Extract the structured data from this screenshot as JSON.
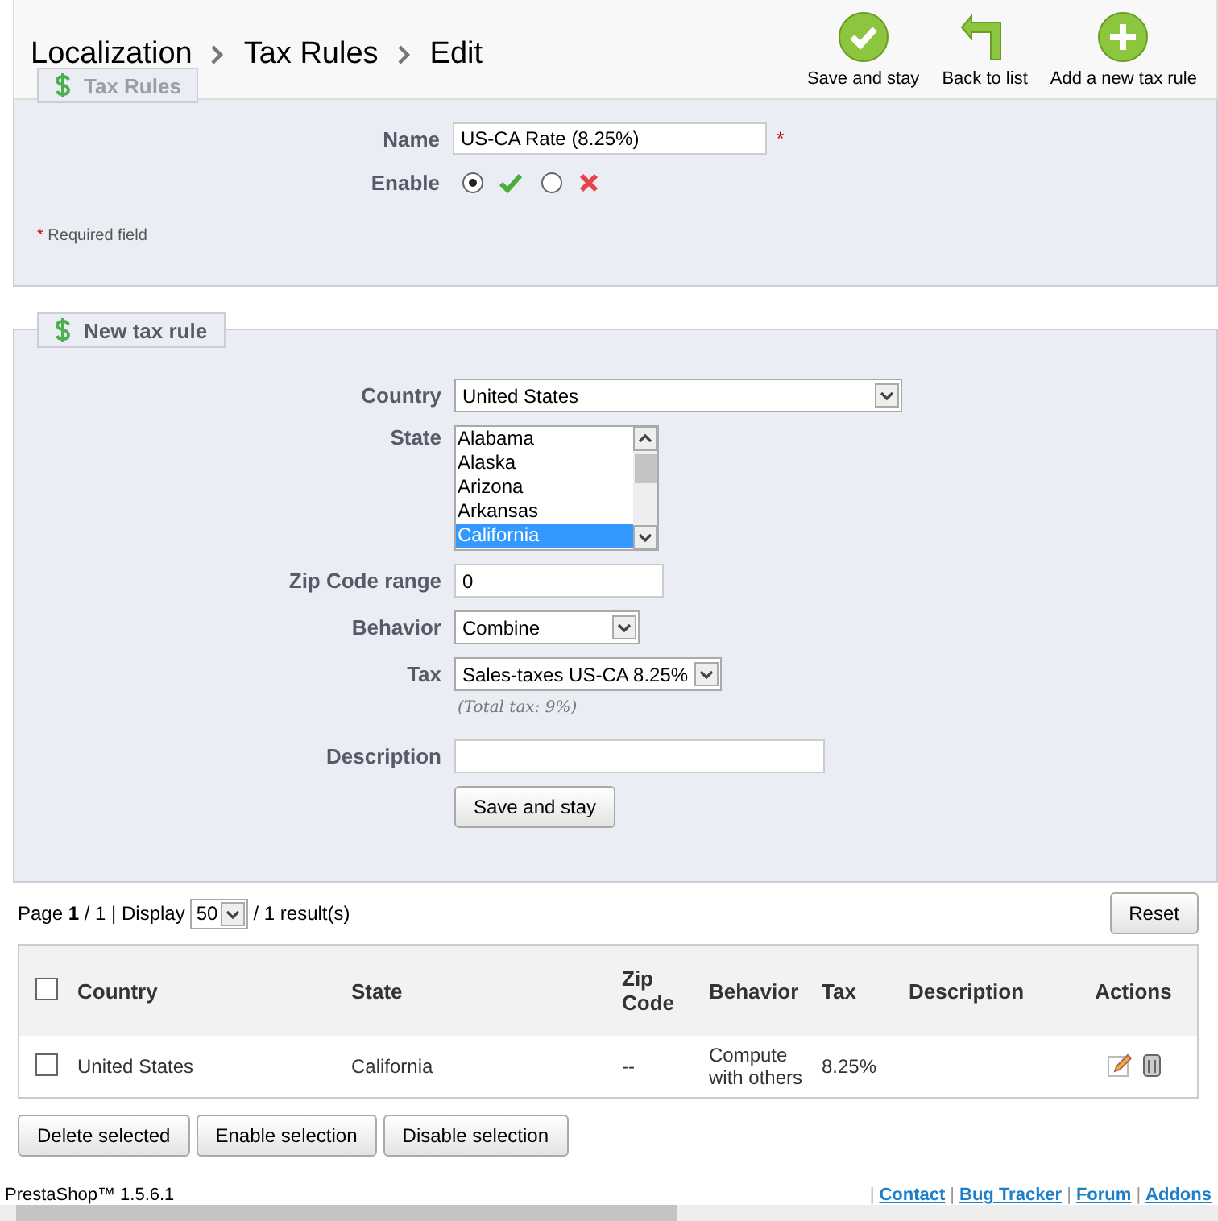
{
  "header": {
    "breadcrumb": [
      "Localization",
      "Tax Rules",
      "Edit"
    ],
    "toolbar": [
      {
        "kind": "save",
        "label": "Save and stay"
      },
      {
        "kind": "back",
        "label": "Back to list"
      },
      {
        "kind": "add",
        "label": "Add a new tax rule"
      }
    ]
  },
  "rule_form": {
    "legend": "Tax Rules",
    "name": {
      "label": "Name",
      "value": "US-CA Rate (8.25%)",
      "required_mark": "*"
    },
    "enable": {
      "label": "Enable",
      "options": [
        {
          "kind": "yes",
          "selected": true
        },
        {
          "kind": "no",
          "selected": false
        }
      ]
    },
    "required_note": {
      "mark": "*",
      "text": "Required field"
    }
  },
  "new_rule": {
    "legend": "New tax rule",
    "country": {
      "label": "Country",
      "value": "United States"
    },
    "state": {
      "label": "State",
      "options": [
        {
          "label": "Alabama",
          "selected": false
        },
        {
          "label": "Alaska",
          "selected": false
        },
        {
          "label": "Arizona",
          "selected": false
        },
        {
          "label": "Arkansas",
          "selected": false
        },
        {
          "label": "California",
          "selected": true
        }
      ]
    },
    "zip": {
      "label": "Zip Code range",
      "value": "0"
    },
    "behavior": {
      "label": "Behavior",
      "value": "Combine"
    },
    "tax": {
      "label": "Tax",
      "value": "Sales-taxes US-CA 8.25%",
      "note": "(Total tax: 9%)"
    },
    "description": {
      "label": "Description"
    },
    "button": "Save and stay"
  },
  "list": {
    "pagination": "Page **1** / 1 | Display",
    "per_page": "50",
    "results": "/ 1 result(s)",
    "reset": "Reset",
    "select_all": {
      "checked": false
    },
    "columns": [
      "Country",
      "State",
      "Zip Code",
      "Behavior",
      "Tax",
      "Description",
      "Actions"
    ],
    "rows": [
      {
        "checked": false,
        "cells": [
          "United States",
          "California",
          "--",
          "Compute with others",
          "8.25%",
          null
        ]
      }
    ],
    "bulk_buttons": [
      "Delete selected",
      "Enable selection",
      "Disable selection"
    ]
  },
  "footer": {
    "version": "PrestaShop™ 1.5.6.1",
    "link_separator": "|",
    "links": [
      "Contact",
      "Bug Tracker",
      "Forum",
      "Addons"
    ]
  }
}
